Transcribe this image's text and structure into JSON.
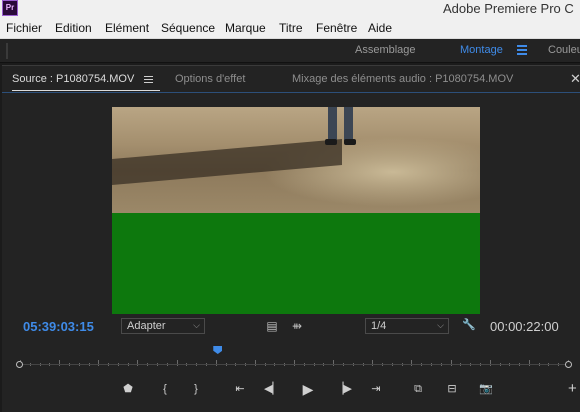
{
  "titlebar": {
    "app_icon": "Pr",
    "title": "Adobe Premiere Pro C"
  },
  "menu": [
    "Fichier",
    "Edition",
    "Elément",
    "Séquence",
    "Marque",
    "Titre",
    "Fenêtre",
    "Aide"
  ],
  "workspace": {
    "tabs": [
      "Assemblage",
      "Montage",
      "Couleu"
    ],
    "active": "Montage"
  },
  "panel": {
    "tabs": [
      "Source : P1080754.MOV",
      "Options d'effet",
      "Mixage des éléments audio : P1080754.MOV"
    ],
    "active_tab": "Source : P1080754.MOV",
    "close_glyph": "✕"
  },
  "controls": {
    "timecode_current": "05:39:03:15",
    "fit_value": "Adapter",
    "resolution_value": "1/4",
    "timecode_duration": "00:00:22:00",
    "dropdown_glyph": "⌵",
    "film_glyph": "▤",
    "arrows_glyph": "⇻",
    "wrench_glyph": "🔧"
  },
  "playhead_fraction": 0.36,
  "transport": [
    {
      "name": "add-marker-icon",
      "glyph": "⬟"
    },
    {
      "name": "mark-in-icon",
      "glyph": "{"
    },
    {
      "name": "mark-out-icon",
      "glyph": "}"
    },
    {
      "name": "go-to-in-icon",
      "glyph": "⇤"
    },
    {
      "name": "step-back-icon",
      "glyph": "◀▏"
    },
    {
      "name": "play-icon",
      "glyph": "▶"
    },
    {
      "name": "step-forward-icon",
      "glyph": "▕▶"
    },
    {
      "name": "go-to-out-icon",
      "glyph": "⇥"
    },
    {
      "name": "insert-icon",
      "glyph": "⧉"
    },
    {
      "name": "overwrite-icon",
      "glyph": "⊟"
    },
    {
      "name": "export-frame-icon",
      "glyph": "📷"
    }
  ],
  "add_button_glyph": "+",
  "colors": {
    "accent": "#3f8be8",
    "panel_bg": "#232323",
    "green_frame": "#0d780d"
  }
}
